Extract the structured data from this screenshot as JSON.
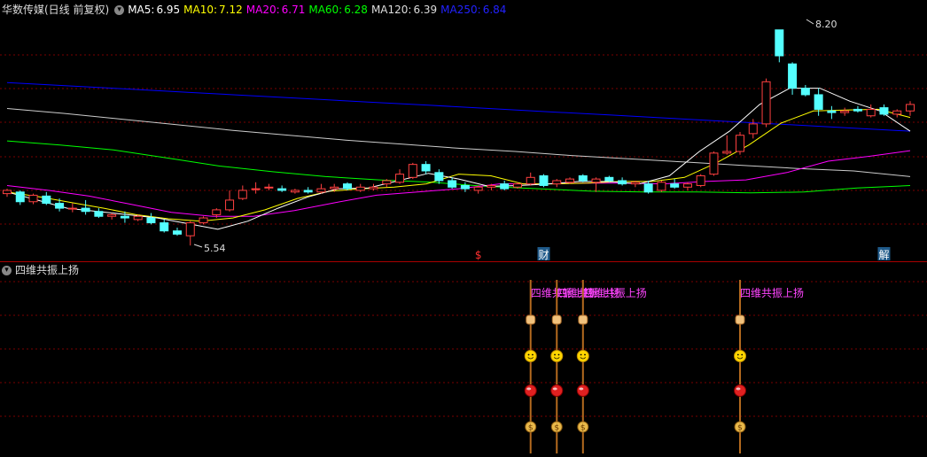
{
  "header": {
    "title": "华数传媒(日线 前复权)",
    "ma": [
      {
        "label": "MA5:",
        "value": "6.95",
        "color": "#ffffff"
      },
      {
        "label": "MA10:",
        "value": "7.12",
        "color": "#ffff00"
      },
      {
        "label": "MA20:",
        "value": "6.71",
        "color": "#ff00ff"
      },
      {
        "label": "MA60:",
        "value": "6.28",
        "color": "#00ff00"
      },
      {
        "label": "MA120:",
        "value": "6.39",
        "color": "#dddddd"
      },
      {
        "label": "MA250:",
        "value": "6.84",
        "color": "#0000ff"
      }
    ]
  },
  "sub_panel": {
    "title": "四维共振上扬"
  },
  "colors": {
    "up": "#ff4040",
    "down": "#54ffff",
    "grid": "#7a0000",
    "bg": "#000000"
  },
  "chart_data": {
    "type": "candlestick",
    "ylim": [
      5.4,
      8.35
    ],
    "max_label": "8.20",
    "min_label": "5.54",
    "candles": [
      [
        6.18,
        6.24,
        6.14,
        6.22
      ],
      [
        6.2,
        6.22,
        6.04,
        6.08
      ],
      [
        6.08,
        6.18,
        6.05,
        6.16
      ],
      [
        6.15,
        6.2,
        6.04,
        6.06
      ],
      [
        6.06,
        6.12,
        5.96,
        6.0
      ],
      [
        6.0,
        6.06,
        5.95,
        6.0
      ],
      [
        6.0,
        6.1,
        5.92,
        5.96
      ],
      [
        5.96,
        6.0,
        5.88,
        5.9
      ],
      [
        5.9,
        5.94,
        5.86,
        5.92
      ],
      [
        5.9,
        5.96,
        5.82,
        5.88
      ],
      [
        5.86,
        5.92,
        5.84,
        5.9
      ],
      [
        5.88,
        5.94,
        5.8,
        5.82
      ],
      [
        5.82,
        5.86,
        5.7,
        5.72
      ],
      [
        5.72,
        5.76,
        5.66,
        5.68
      ],
      [
        5.66,
        5.84,
        5.54,
        5.82
      ],
      [
        5.82,
        5.9,
        5.8,
        5.88
      ],
      [
        5.92,
        6.0,
        5.88,
        5.98
      ],
      [
        5.98,
        6.22,
        5.96,
        6.1
      ],
      [
        6.12,
        6.28,
        6.1,
        6.22
      ],
      [
        6.24,
        6.32,
        6.18,
        6.24
      ],
      [
        6.26,
        6.3,
        6.22,
        6.26
      ],
      [
        6.24,
        6.28,
        6.2,
        6.22
      ],
      [
        6.2,
        6.24,
        6.18,
        6.22
      ],
      [
        6.22,
        6.26,
        6.18,
        6.2
      ],
      [
        6.2,
        6.3,
        6.18,
        6.24
      ],
      [
        6.24,
        6.3,
        6.2,
        6.26
      ],
      [
        6.3,
        6.32,
        6.22,
        6.24
      ],
      [
        6.22,
        6.3,
        6.2,
        6.26
      ],
      [
        6.24,
        6.3,
        6.22,
        6.26
      ],
      [
        6.3,
        6.36,
        6.26,
        6.34
      ],
      [
        6.32,
        6.48,
        6.3,
        6.42
      ],
      [
        6.38,
        6.56,
        6.36,
        6.54
      ],
      [
        6.54,
        6.58,
        6.42,
        6.46
      ],
      [
        6.44,
        6.48,
        6.3,
        6.34
      ],
      [
        6.34,
        6.38,
        6.24,
        6.26
      ],
      [
        6.28,
        6.32,
        6.2,
        6.24
      ],
      [
        6.22,
        6.28,
        6.18,
        6.26
      ],
      [
        6.26,
        6.3,
        6.22,
        6.28
      ],
      [
        6.3,
        6.34,
        6.22,
        6.24
      ],
      [
        6.26,
        6.32,
        6.24,
        6.3
      ],
      [
        6.3,
        6.44,
        6.28,
        6.38
      ],
      [
        6.4,
        6.42,
        6.26,
        6.28
      ],
      [
        6.3,
        6.36,
        6.26,
        6.34
      ],
      [
        6.32,
        6.38,
        6.3,
        6.36
      ],
      [
        6.4,
        6.42,
        6.32,
        6.34
      ],
      [
        6.32,
        6.38,
        6.2,
        6.36
      ],
      [
        6.38,
        6.4,
        6.32,
        6.34
      ],
      [
        6.34,
        6.38,
        6.28,
        6.3
      ],
      [
        6.3,
        6.34,
        6.26,
        6.32
      ],
      [
        6.3,
        6.34,
        6.18,
        6.2
      ],
      [
        6.22,
        6.34,
        6.2,
        6.32
      ],
      [
        6.3,
        6.36,
        6.24,
        6.26
      ],
      [
        6.26,
        6.32,
        6.22,
        6.3
      ],
      [
        6.28,
        6.42,
        6.26,
        6.4
      ],
      [
        6.42,
        6.7,
        6.4,
        6.68
      ],
      [
        6.68,
        6.9,
        6.66,
        6.7
      ],
      [
        6.7,
        6.94,
        6.66,
        6.9
      ],
      [
        6.92,
        7.1,
        6.86,
        7.04
      ],
      [
        7.04,
        7.6,
        7.0,
        7.56
      ],
      [
        8.2,
        8.2,
        7.8,
        7.88
      ],
      [
        7.78,
        7.8,
        7.4,
        7.48
      ],
      [
        7.48,
        7.52,
        7.38,
        7.4
      ],
      [
        7.4,
        7.48,
        7.14,
        7.22
      ],
      [
        7.2,
        7.26,
        7.1,
        7.18
      ],
      [
        7.18,
        7.24,
        7.14,
        7.2
      ],
      [
        7.22,
        7.26,
        7.18,
        7.2
      ],
      [
        7.14,
        7.28,
        7.12,
        7.22
      ],
      [
        7.24,
        7.28,
        7.14,
        7.16
      ],
      [
        7.16,
        7.22,
        7.12,
        7.2
      ],
      [
        7.2,
        7.32,
        7.14,
        7.28
      ]
    ],
    "series": [
      {
        "name": "MA250",
        "color": "#0000ff",
        "values": [
          7.55,
          7.51,
          7.47,
          7.43,
          7.39,
          7.35,
          7.31,
          7.27,
          7.23,
          7.19,
          7.15,
          7.11,
          7.07,
          7.03,
          6.99,
          6.95
        ]
      },
      {
        "name": "MA120",
        "color": "#cccccc",
        "values": [
          7.23,
          7.17,
          7.1,
          7.03,
          6.96,
          6.9,
          6.84,
          6.79,
          6.74,
          6.7,
          6.65,
          6.61,
          6.57,
          6.53,
          6.49,
          6.46,
          6.39
        ]
      },
      {
        "name": "MA60",
        "color": "#00ff00",
        "values": [
          6.83,
          6.78,
          6.72,
          6.62,
          6.52,
          6.45,
          6.39,
          6.35,
          6.32,
          6.27,
          6.24,
          6.21,
          6.2,
          6.2,
          6.19,
          6.2,
          6.25,
          6.28
        ]
      },
      {
        "name": "MA20",
        "color": "#ff00ff",
        "values": [
          6.28,
          6.22,
          6.15,
          6.05,
          5.95,
          5.9,
          5.9,
          5.97,
          6.07,
          6.16,
          6.2,
          6.24,
          6.3,
          6.3,
          6.31,
          6.31,
          6.3,
          6.33,
          6.35,
          6.44,
          6.58,
          6.64,
          6.71
        ]
      },
      {
        "name": "MA10",
        "color": "#ffff00",
        "values": [
          6.2,
          6.14,
          6.07,
          6.0,
          5.92,
          5.87,
          5.84,
          5.88,
          5.98,
          6.12,
          6.21,
          6.24,
          6.26,
          6.3,
          6.42,
          6.4,
          6.3,
          6.3,
          6.31,
          6.33,
          6.33,
          6.38,
          6.56,
          6.78,
          7.05,
          7.2,
          7.21,
          7.22,
          7.12
        ]
      },
      {
        "name": "MA5",
        "color": "#ffffff",
        "values": [
          6.2,
          6.1,
          6.0,
          5.96,
          5.92,
          5.88,
          5.81,
          5.74,
          5.84,
          6.0,
          6.14,
          6.24,
          6.25,
          6.34,
          6.43,
          6.36,
          6.27,
          6.28,
          6.3,
          6.33,
          6.33,
          6.3,
          6.4,
          6.7,
          6.95,
          7.28,
          7.48,
          7.48,
          7.32,
          7.2,
          6.95
        ]
      }
    ],
    "markers": [
      {
        "label": "$",
        "color": "#ff3030",
        "candle": 36
      },
      {
        "label": "财",
        "color": "#ffffff",
        "candle": 41
      },
      {
        "label": "解",
        "color": "#ffffff",
        "candle": 67
      }
    ],
    "signals": [
      {
        "label": "四维共振上扬",
        "candle": 40
      },
      {
        "label": "四维共振上扬",
        "candle": 42
      },
      {
        "label": "四维共振上扬",
        "candle": 44
      },
      {
        "label": "四维共振上扬",
        "candle": 56
      }
    ]
  }
}
